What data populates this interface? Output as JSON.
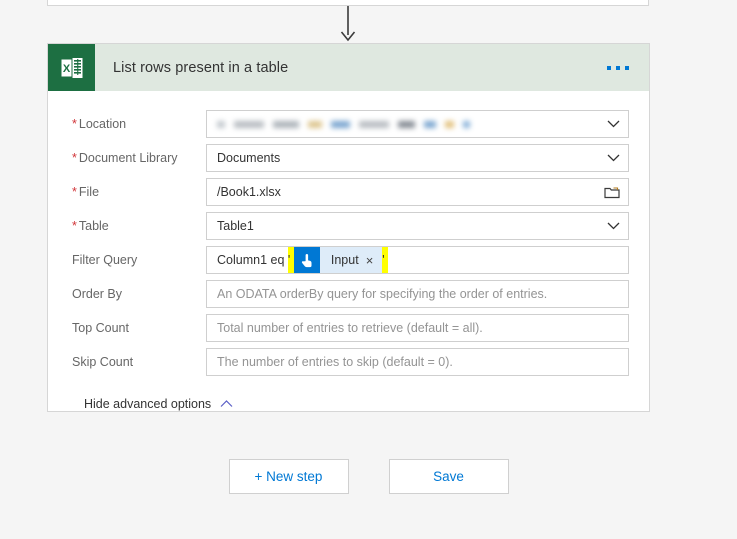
{
  "previous_step": {
    "name": "previous-step-card-partial"
  },
  "connector_arrow": {
    "name": "flow-connector-arrow"
  },
  "action_card": {
    "title": "List rows present in a table",
    "icon": "excel-icon",
    "icon_color": "#1d6f42",
    "header_bg": "#dfe8e0",
    "menu_label": "•••",
    "fields": [
      {
        "label": "Location",
        "required": true,
        "value": "",
        "redacted": true,
        "affix": "chevron-down-icon"
      },
      {
        "label": "Document Library",
        "required": true,
        "value": "Documents",
        "redacted": false,
        "affix": "chevron-down-icon"
      },
      {
        "label": "File",
        "required": true,
        "value": "/Book1.xlsx",
        "redacted": false,
        "affix": "folder-icon"
      },
      {
        "label": "Table",
        "required": true,
        "value": "Table1",
        "redacted": false,
        "affix": "chevron-down-icon"
      }
    ],
    "filter_query": {
      "label": "Filter Query",
      "required": false,
      "text_prefix": "Column1 eq ",
      "open_quote": "'",
      "close_quote": "'",
      "token": {
        "label": "Input",
        "icon": "manual-trigger-hand-icon",
        "remove_label": "×",
        "icon_bg": "#0078d4",
        "chip_bg": "#deecf9"
      },
      "highlight_color": "#ffff00"
    },
    "placeholder_fields": [
      {
        "label": "Order By",
        "required": false,
        "placeholder": "An ODATA orderBy query for specifying the order of entries."
      },
      {
        "label": "Top Count",
        "required": false,
        "placeholder": "Total number of entries to retrieve (default = all)."
      },
      {
        "label": "Skip Count",
        "required": false,
        "placeholder": "The number of entries to skip (default = 0)."
      }
    ],
    "advanced_toggle": {
      "label": "Hide advanced options",
      "icon": "chevron-up-icon"
    }
  },
  "footer": {
    "new_step_label": "+ New step",
    "save_label": "Save",
    "accent_color": "#0078d4"
  }
}
